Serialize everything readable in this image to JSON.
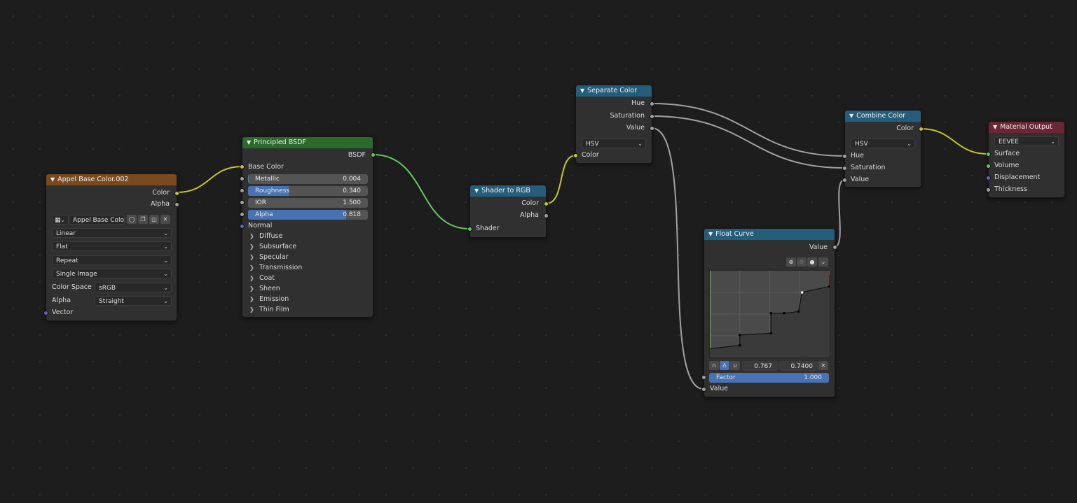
{
  "colors": {
    "image_header": "#7a4a1f",
    "shader_header": "#2c6a2c",
    "converter_header": "#245e7c",
    "output_header": "#6a2633",
    "color_socket": "#c7c729",
    "shader_socket": "#63c763",
    "float_socket": "#a1a1a1",
    "vector_socket": "#6363c7",
    "slider_fill": "#4772b3"
  },
  "image_node": {
    "title": "Appel Base Color.002",
    "outputs": {
      "color": "Color",
      "alpha": "Alpha"
    },
    "image_name": "Appel Base Colo...",
    "interpolation": "Linear",
    "projection": "Flat",
    "extension": "Repeat",
    "source": "Single Image",
    "color_space_label": "Color Space",
    "color_space_value": "sRGB",
    "alpha_label": "Alpha",
    "alpha_value": "Straight",
    "input_vector": "Vector"
  },
  "bsdf_node": {
    "title": "Principled BSDF",
    "output": "BSDF",
    "base_color": "Base Color",
    "metallic": {
      "label": "Metallic",
      "value": "0.004",
      "fraction": 0.004
    },
    "roughness": {
      "label": "Roughness",
      "value": "0.340",
      "fraction": 0.34
    },
    "ior": {
      "label": "IOR",
      "value": "1.500",
      "fraction": 0
    },
    "alpha": {
      "label": "Alpha",
      "value": "0.818",
      "fraction": 0.818
    },
    "normal": "Normal",
    "panels": [
      "Diffuse",
      "Subsurface",
      "Specular",
      "Transmission",
      "Coat",
      "Sheen",
      "Emission",
      "Thin Film"
    ]
  },
  "shader_to_rgb": {
    "title": "Shader to RGB",
    "output_color": "Color",
    "output_alpha": "Alpha",
    "input_shader": "Shader"
  },
  "separate_color": {
    "title": "Separate Color",
    "outputs": {
      "hue": "Hue",
      "saturation": "Saturation",
      "value": "Value"
    },
    "mode": "HSV",
    "input_color": "Color"
  },
  "combine_color": {
    "title": "Combine Color",
    "output_color": "Color",
    "mode": "HSV",
    "inputs": {
      "hue": "Hue",
      "saturation": "Saturation",
      "value": "Value"
    }
  },
  "material_output": {
    "title": "Material Output",
    "target": "EEVEE",
    "inputs": {
      "surface": "Surface",
      "volume": "Volume",
      "displacement": "Displacement",
      "thickness": "Thickness"
    }
  },
  "float_curve": {
    "title": "Float Curve",
    "output_value": "Value",
    "point_x": "0.767",
    "point_y": "0.7400",
    "factor": {
      "label": "Factor",
      "value": "1.000",
      "fraction": 1.0
    },
    "input_value": "Value",
    "curve_points": [
      [
        0.0,
        0.1
      ],
      [
        0.25,
        0.14
      ],
      [
        0.25,
        0.26
      ],
      [
        0.51,
        0.28
      ],
      [
        0.51,
        0.51
      ],
      [
        0.62,
        0.51
      ],
      [
        0.74,
        0.53
      ],
      [
        0.77,
        0.75
      ],
      [
        1.0,
        0.82
      ],
      [
        1.0,
        0.95
      ]
    ]
  }
}
